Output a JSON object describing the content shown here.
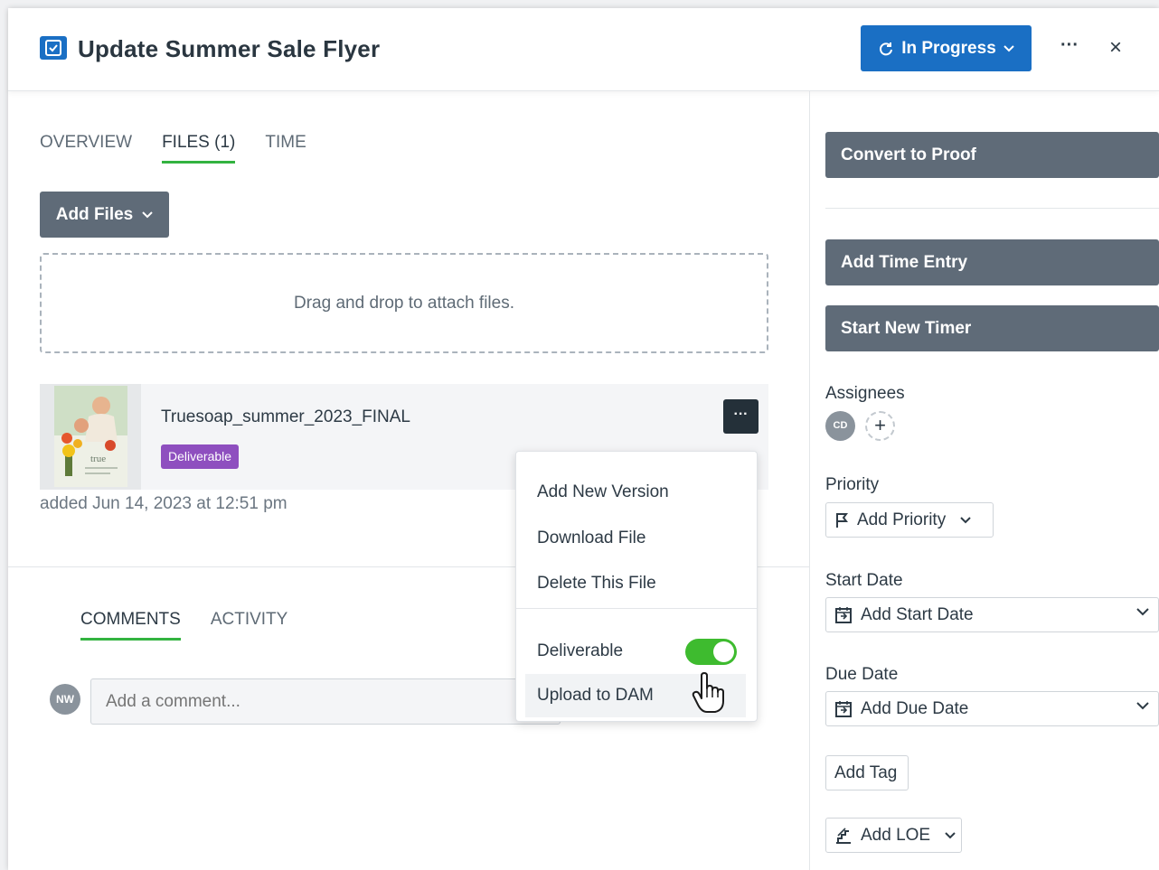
{
  "header": {
    "title": "Update Summer Sale Flyer",
    "title_icon": "task-checkbox-icon",
    "status_label": "In Progress",
    "more_label": "···",
    "close_label": "×"
  },
  "tabs": [
    {
      "label": "OVERVIEW",
      "active": false
    },
    {
      "label": "FILES (1)",
      "active": true
    },
    {
      "label": "TIME",
      "active": false
    }
  ],
  "files": {
    "add_files_label": "Add Files",
    "dropzone_text": "Drag and drop to attach files.",
    "file": {
      "name": "Truesoap_summer_2023_FINAL",
      "badge": "Deliverable",
      "added": "added Jun 14, 2023 at 12:51 pm",
      "thumb_brand": "true",
      "more_label": "···"
    }
  },
  "file_menu": {
    "items": [
      "Add New Version",
      "Download File",
      "Delete This File"
    ],
    "deliverable_label": "Deliverable",
    "deliverable_on": true,
    "upload_label": "Upload to DAM"
  },
  "comments": {
    "tabs": [
      {
        "label": "COMMENTS",
        "active": true
      },
      {
        "label": "ACTIVITY",
        "active": false
      }
    ],
    "avatar_initials": "NW",
    "placeholder": "Add a comment..."
  },
  "sidebar": {
    "convert_label": "Convert to Proof",
    "add_time_label": "Add Time Entry",
    "timer_label": "Start New Timer",
    "assignees_label": "Assignees",
    "assignee_initials": "CD",
    "add_assignee_label": "+",
    "priority_label": "Priority",
    "priority_value": "Add Priority",
    "start_date_label": "Start Date",
    "start_date_value": "Add Start Date",
    "due_date_label": "Due Date",
    "due_date_value": "Add Due Date",
    "add_tag_label": "Add Tag",
    "loe_value": "Add LOE"
  },
  "colors": {
    "primary": "#1a6fc4",
    "secondary_button": "#5f6b78",
    "tab_underline": "#33b340",
    "badge": "#8e4fbf",
    "toggle_on": "#3ebb2f"
  }
}
